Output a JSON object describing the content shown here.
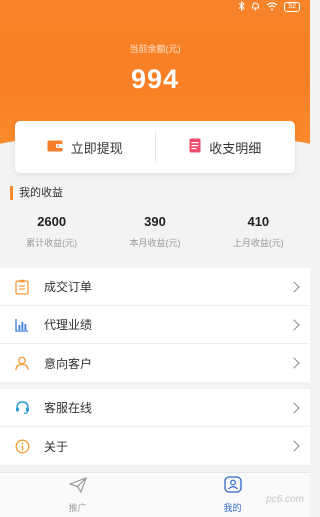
{
  "status_bar": {
    "battery": "52"
  },
  "balance": {
    "label": "当前余额(元)",
    "value": "994"
  },
  "actions": {
    "withdraw": "立即提现",
    "statement": "收支明细"
  },
  "earnings": {
    "title": "我的收益",
    "stats": [
      {
        "value": "2600",
        "label": "累计收益(元)"
      },
      {
        "value": "390",
        "label": "本月收益(元)"
      },
      {
        "value": "410",
        "label": "上月收益(元)"
      }
    ]
  },
  "menu_group1": [
    {
      "label": "成交订单",
      "icon": "clipboard-icon"
    },
    {
      "label": "代理业绩",
      "icon": "bar-chart-icon"
    },
    {
      "label": "意向客户",
      "icon": "user-icon"
    }
  ],
  "menu_group2": [
    {
      "label": "客服在线",
      "icon": "headset-icon"
    },
    {
      "label": "关于",
      "icon": "info-icon"
    }
  ],
  "tabs": [
    {
      "label": "推广",
      "icon": "paper-plane-icon"
    },
    {
      "label": "我的",
      "icon": "profile-icon",
      "active": true
    }
  ],
  "watermark": "pc6.com",
  "colors": {
    "accent": "#f8862b",
    "tab_active": "#2f64c8"
  }
}
